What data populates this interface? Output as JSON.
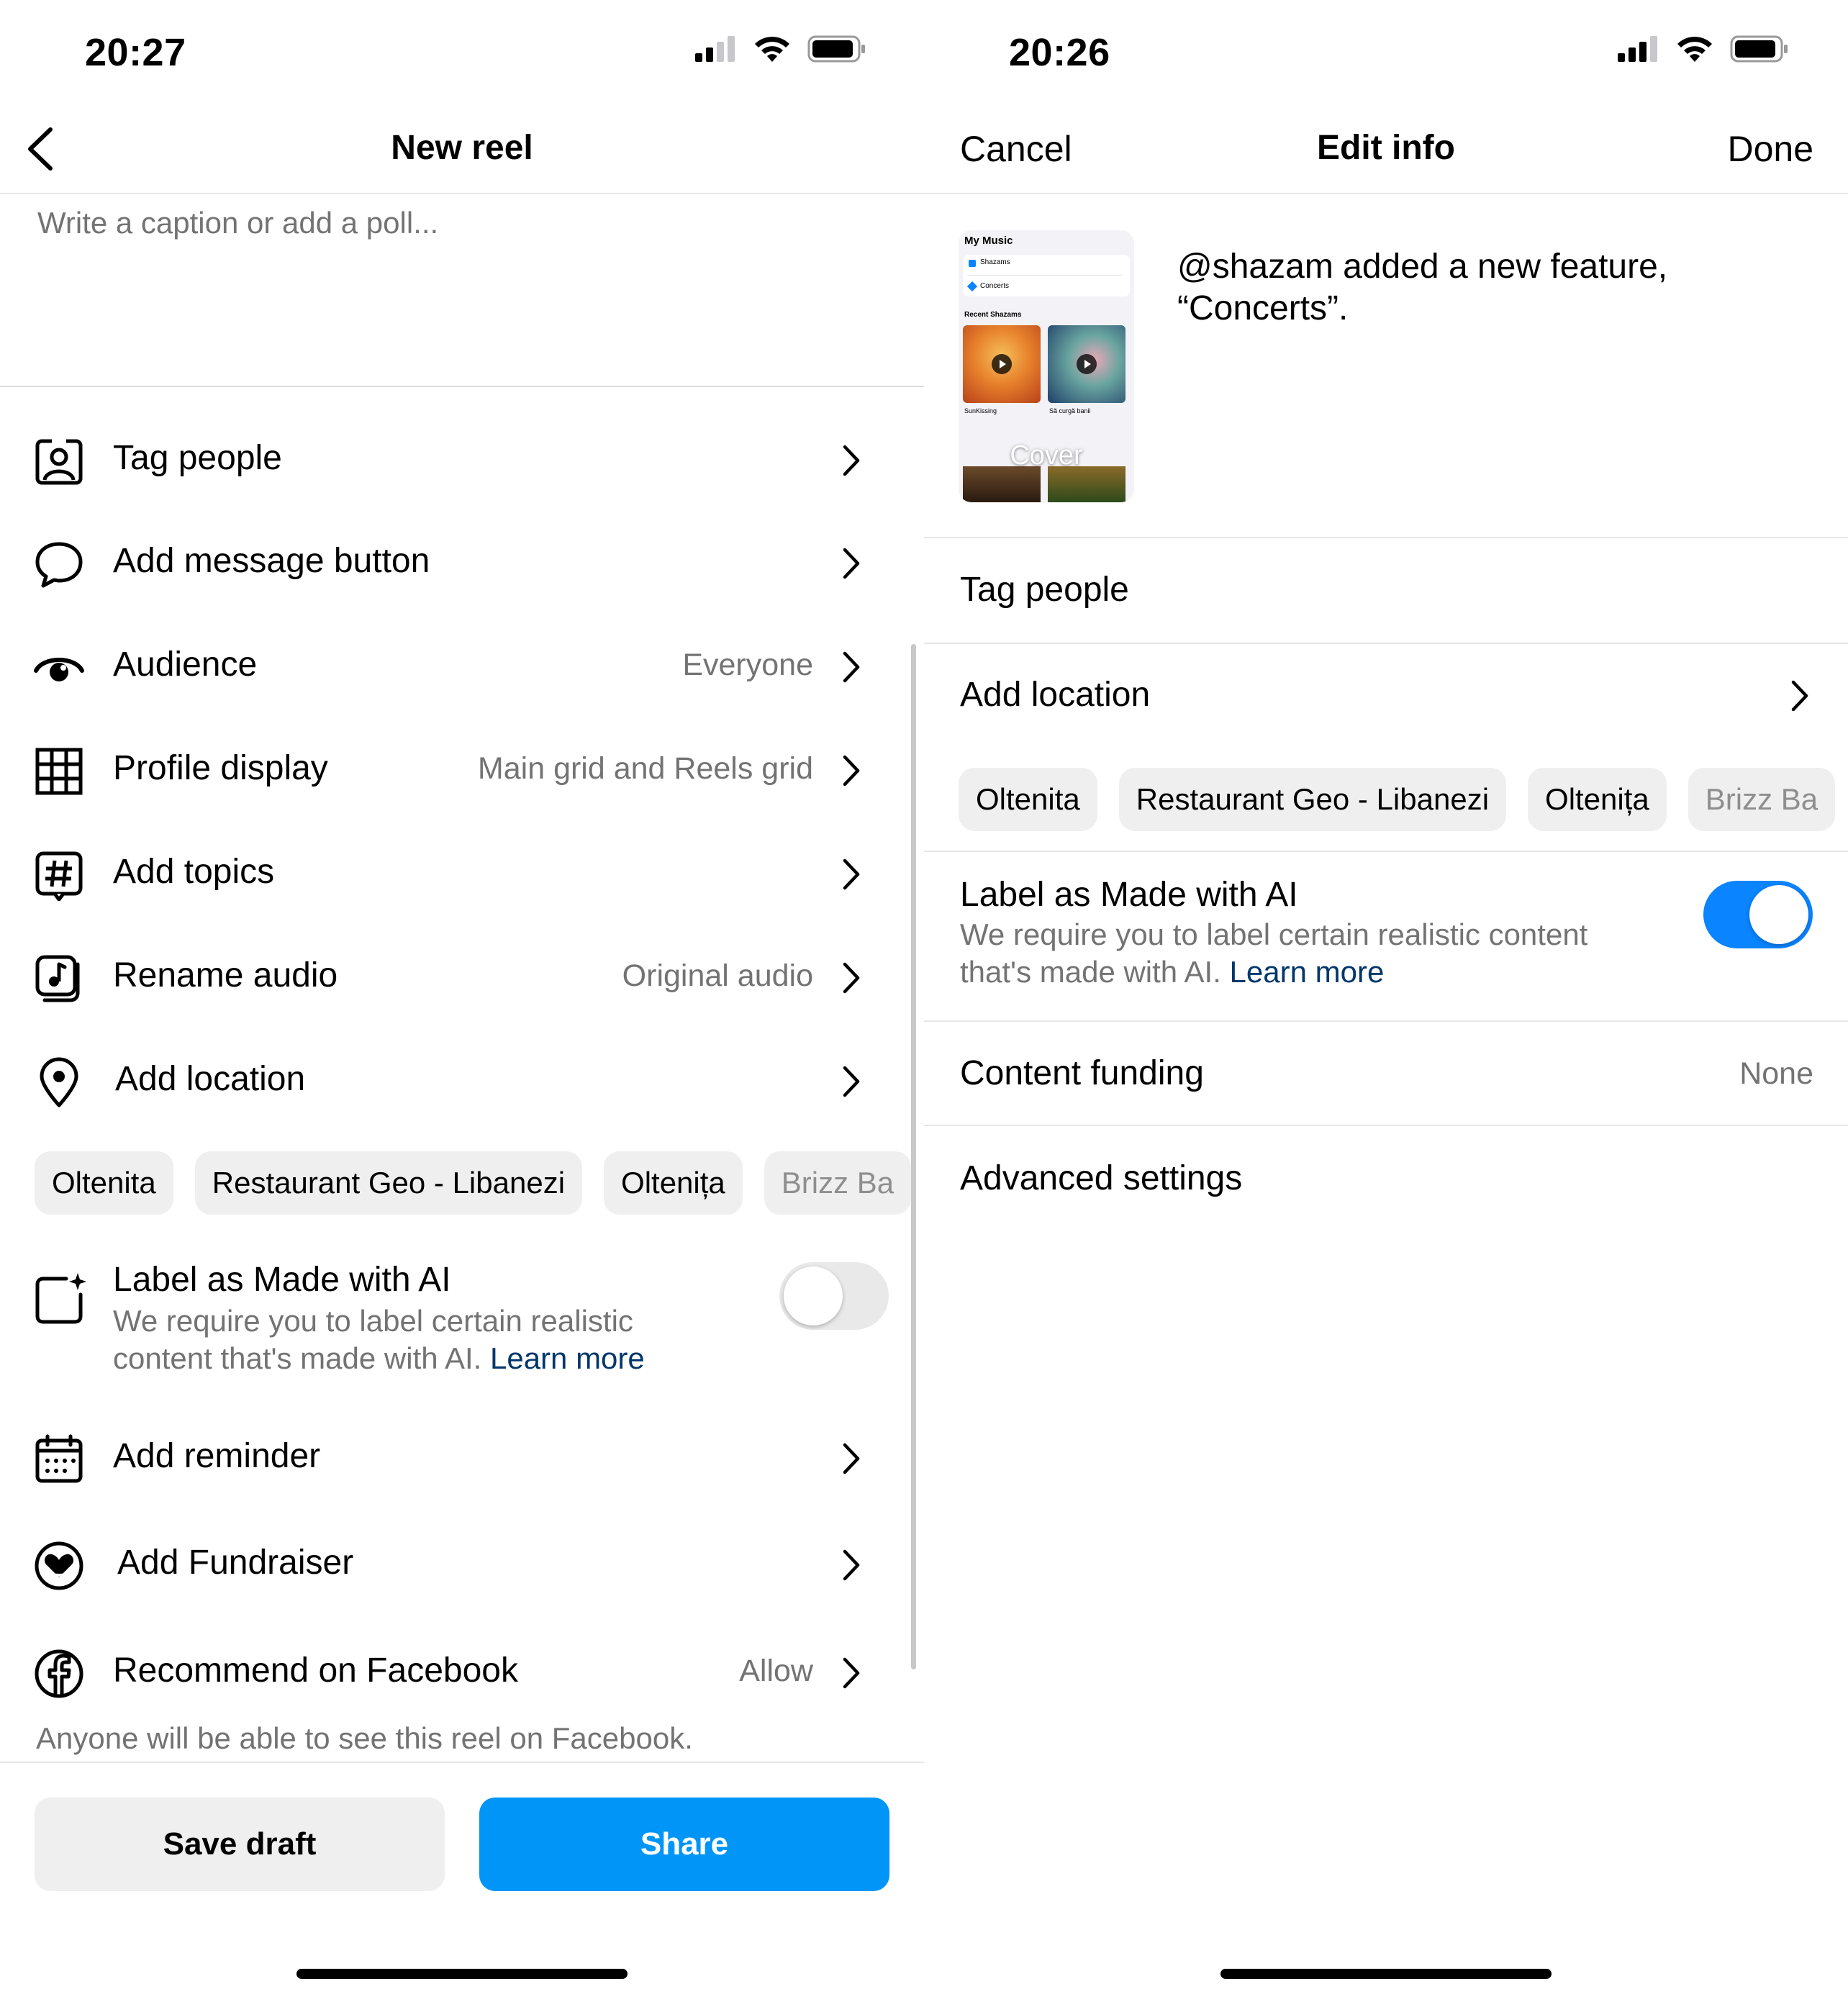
{
  "left": {
    "status": {
      "time": "20:27"
    },
    "header": {
      "title": "New reel"
    },
    "caption": {
      "placeholder": "Write a caption or add a poll..."
    },
    "rows": {
      "tag_people": {
        "label": "Tag people"
      },
      "message_button": {
        "label": "Add message button"
      },
      "audience": {
        "label": "Audience",
        "value": "Everyone"
      },
      "profile_display": {
        "label": "Profile display",
        "value": "Main grid and Reels grid"
      },
      "topics": {
        "label": "Add topics"
      },
      "rename_audio": {
        "label": "Rename audio",
        "value": "Original audio"
      },
      "location": {
        "label": "Add location"
      },
      "reminder": {
        "label": "Add reminder"
      },
      "fundraiser": {
        "label": "Add Fundraiser"
      },
      "facebook": {
        "label": "Recommend on Facebook",
        "value": "Allow"
      }
    },
    "location_chips": [
      "Oltenita",
      "Restaurant Geo - Libanezi",
      "Oltenița",
      "Brizz Ba"
    ],
    "ai_label": {
      "title": "Label as Made with AI",
      "desc_line1": "We require you to label certain realistic",
      "desc_line2": "content that's made with AI.",
      "learn_more": "Learn more",
      "enabled": false
    },
    "facebook_note": "Anyone will be able to see this reel on Facebook.",
    "buttons": {
      "save_draft": "Save draft",
      "share": "Share"
    }
  },
  "right": {
    "status": {
      "time": "20:26"
    },
    "header": {
      "cancel": "Cancel",
      "title": "Edit info",
      "done": "Done"
    },
    "thumbnail": {
      "app_title": "My Music",
      "shazams": "Shazams",
      "concerts": "Concerts",
      "recent": "Recent Shazams",
      "song1": "SunKissing",
      "song2": "Să curgă banii",
      "cover_label": "Cover"
    },
    "caption_text": "@shazam added a new feature, “Concerts”.",
    "tag_people": "Tag people",
    "add_location": "Add location",
    "location_chips": [
      "Oltenita",
      "Restaurant Geo - Libanezi",
      "Oltenița",
      "Brizz Ba"
    ],
    "ai_label": {
      "title": "Label as Made with AI",
      "desc_line1": "We require you to label certain realistic content",
      "desc_line2": "that's made with AI.",
      "learn_more": "Learn more",
      "enabled": true
    },
    "content_funding": {
      "label": "Content funding",
      "value": "None"
    },
    "advanced_settings": "Advanced settings"
  },
  "colors": {
    "accent_blue": "#0095f6",
    "toggle_on": "#0a84ff",
    "link_blue": "#00376b",
    "secondary_text": "#737373"
  }
}
